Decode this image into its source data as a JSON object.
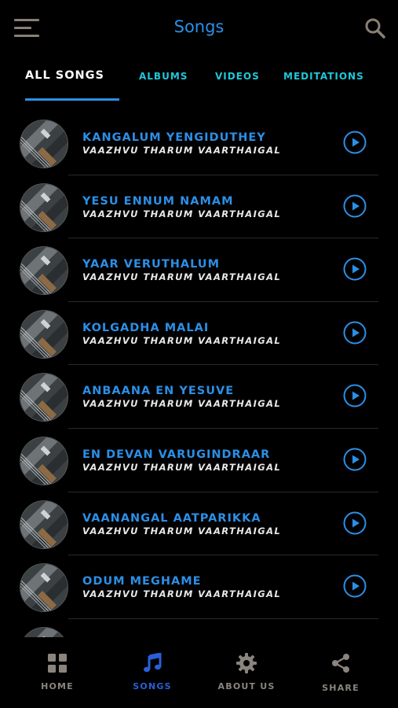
{
  "header": {
    "title": "Songs",
    "menu_icon": "hamburger-menu-icon",
    "search_icon": "search-icon"
  },
  "tabs": [
    {
      "label": "ALL SONGS",
      "active": true
    },
    {
      "label": "ALBUMS",
      "active": false
    },
    {
      "label": "VIDEOS",
      "active": false
    },
    {
      "label": "MEDITATIONS",
      "active": false
    }
  ],
  "songs": [
    {
      "title": "KANGALUM YENGIDUTHEY",
      "album": "VAAZHVU THARUM VAARTHAIGAL"
    },
    {
      "title": "YESU ENNUM NAMAM",
      "album": "VAAZHVU THARUM VAARTHAIGAL"
    },
    {
      "title": "YAAR VERUTHALUM",
      "album": "VAAZHVU THARUM VAARTHAIGAL"
    },
    {
      "title": "KOLGADHA MALAI",
      "album": "VAAZHVU THARUM VAARTHAIGAL"
    },
    {
      "title": "ANBAANA EN YESUVE",
      "album": "VAAZHVU THARUM VAARTHAIGAL"
    },
    {
      "title": "EN DEVAN VARUGINDRAAR",
      "album": "VAAZHVU THARUM VAARTHAIGAL"
    },
    {
      "title": "VAANANGAL AATPARIKKA",
      "album": "VAAZHVU THARUM VAARTHAIGAL"
    },
    {
      "title": "ODUM MEGHAME",
      "album": "VAAZHVU THARUM VAARTHAIGAL"
    }
  ],
  "bottom_nav": [
    {
      "label": "HOME",
      "icon": "grid-icon",
      "active": false
    },
    {
      "label": "SONGS",
      "icon": "music-note-icon",
      "active": true
    },
    {
      "label": "ABOUT US",
      "icon": "gear-icon",
      "active": false
    },
    {
      "label": "SHARE",
      "icon": "share-icon",
      "active": false
    }
  ],
  "colors": {
    "accent": "#2c8fe6",
    "tab_inactive": "#1fc7d8",
    "nav_active": "#2a5fd8",
    "nav_inactive": "#8a847d",
    "icon_muted": "#8a7f74",
    "background": "#000000"
  }
}
